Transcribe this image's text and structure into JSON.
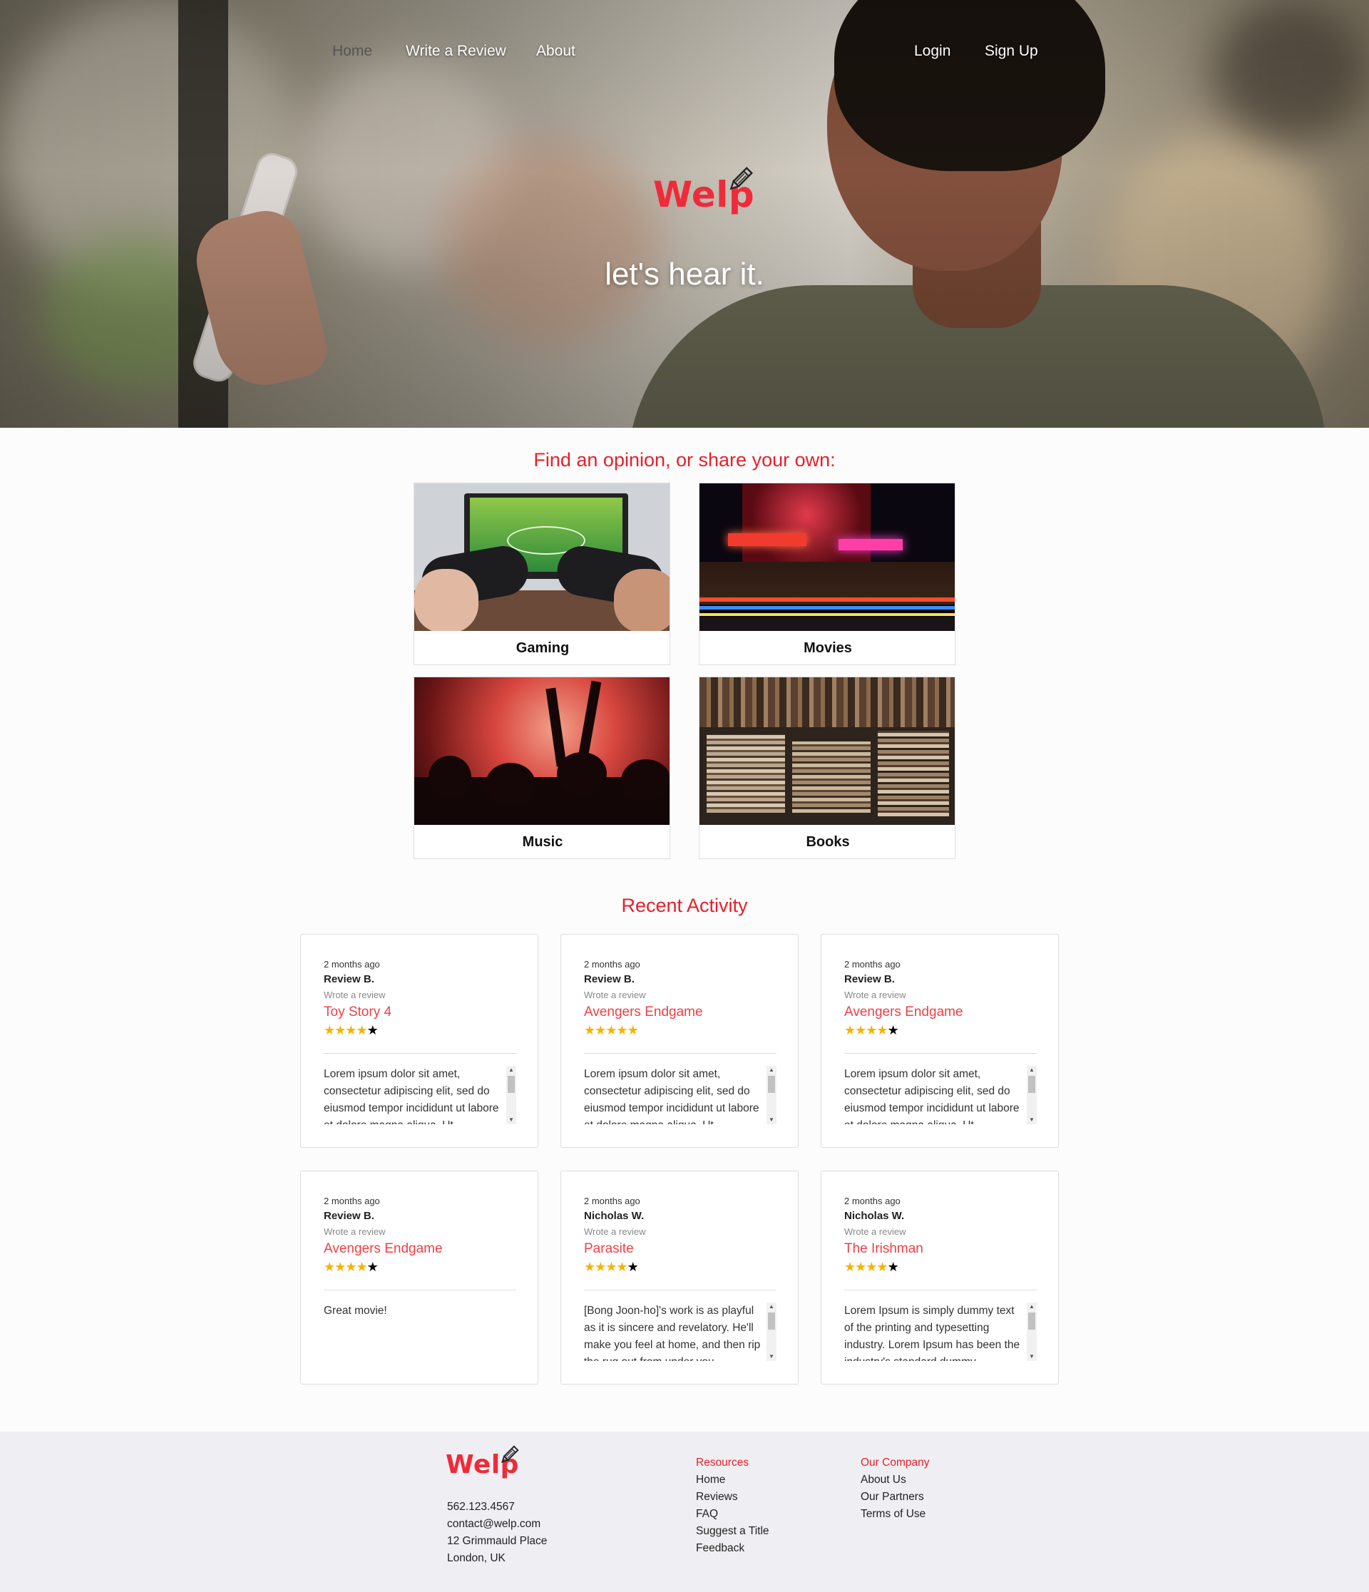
{
  "nav": {
    "home": "Home",
    "write_review": "Write a Review",
    "about": "About",
    "login": "Login",
    "signup": "Sign Up"
  },
  "brand": {
    "name": "Welp",
    "color": "#ee2b3a",
    "icon": "pencil-icon"
  },
  "hero": {
    "tagline": "let's hear it."
  },
  "categories": {
    "heading": "Find an opinion, or share your own:",
    "items": [
      {
        "label": "Gaming",
        "image": "game-controllers-image"
      },
      {
        "label": "Movies",
        "image": "cinema-marquee-image"
      },
      {
        "label": "Music",
        "image": "concert-crowd-image"
      },
      {
        "label": "Books",
        "image": "book-stacks-image"
      }
    ]
  },
  "activity": {
    "heading": "Recent Activity",
    "reviews": [
      {
        "time": "2 months ago",
        "user": "Review B.",
        "action": "Wrote a review",
        "title": "Toy Story 4",
        "rating": 4,
        "text": "Lorem ipsum dolor sit amet, consectetur adipiscing elit, sed do eiusmod tempor incididunt ut labore et dolore magna aliqua. Ut",
        "scrollable": true
      },
      {
        "time": "2 months ago",
        "user": "Review B.",
        "action": "Wrote a review",
        "title": "Avengers Endgame",
        "rating": 5,
        "text": "Lorem ipsum dolor sit amet, consectetur adipiscing elit, sed do eiusmod tempor incididunt ut labore et dolore magna aliqua. Ut",
        "scrollable": true
      },
      {
        "time": "2 months ago",
        "user": "Review B.",
        "action": "Wrote a review",
        "title": "Avengers Endgame",
        "rating": 4,
        "text": "Lorem ipsum dolor sit amet, consectetur adipiscing elit, sed do eiusmod tempor incididunt ut labore et dolore magna aliqua. Ut",
        "scrollable": true
      },
      {
        "time": "2 months ago",
        "user": "Review B.",
        "action": "Wrote a review",
        "title": "Avengers Endgame",
        "rating": 4,
        "text": "Great movie!",
        "scrollable": false
      },
      {
        "time": "2 months ago",
        "user": "Nicholas W.",
        "action": "Wrote a review",
        "title": "Parasite",
        "rating": 4,
        "text": "[Bong Joon-ho]'s work is as playful as it is sincere and revelatory. He'll make you feel at home, and then rip the rug out from under you.",
        "scrollable": true
      },
      {
        "time": "2 months ago",
        "user": "Nicholas W.",
        "action": "Wrote a review",
        "title": "The Irishman",
        "rating": 4,
        "text": "Lorem Ipsum is simply dummy text of the printing and typesetting industry. Lorem Ipsum has been the industry's standard dummy",
        "scrollable": true
      }
    ]
  },
  "footer": {
    "phone": "562.123.4567",
    "email": "contact@welp.com",
    "address1": "12 Grimmauld Place",
    "address2": "London, UK",
    "resources_heading": "Resources",
    "resources": [
      "Home",
      "Reviews",
      "FAQ",
      "Suggest a Title",
      "Feedback"
    ],
    "company_heading": "Our Company",
    "company": [
      "About Us",
      "Our Partners",
      "Terms of Use"
    ]
  },
  "colors": {
    "accent": "#e6202a",
    "review_title": "#ee4047",
    "star": "#f5b301",
    "footer_bg": "#efeff3"
  }
}
